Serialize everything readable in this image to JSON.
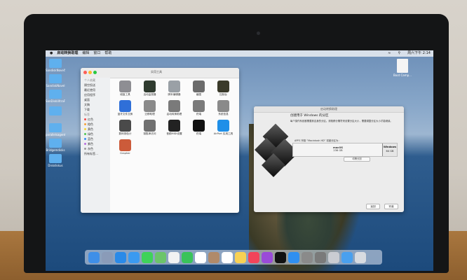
{
  "menubar": {
    "app": "启动转换助理",
    "items": [
      "编辑",
      "窗口",
      "帮助"
    ],
    "clock": "周六下午 2:14"
  },
  "desktop_icons": [
    {
      "label": "SandiskNovel5",
      "icon": "folder-icon"
    },
    {
      "label": "SandiskNovel",
      "icon": "folder-icon"
    },
    {
      "label": "SanDiskUltraFit",
      "icon": "folder-icon"
    },
    {
      "label": "",
      "icon": "folder-icon"
    },
    {
      "label": "parallelsagents",
      "icon": "folder-icon"
    },
    {
      "label": "Bridgemdisks",
      "icon": "folder-icon"
    },
    {
      "label": "Diskdiskus",
      "icon": "folder-icon"
    }
  ],
  "desktop_doc": {
    "label": "Boot Camp...",
    "icon": "document-icon"
  },
  "finder": {
    "title": "实用工具",
    "sidebar": [
      {
        "label": "个人收藏",
        "header": true
      },
      {
        "label": "隔空投送"
      },
      {
        "label": "最近使用"
      },
      {
        "label": "应用程序"
      },
      {
        "label": "桌面"
      },
      {
        "label": "文稿"
      },
      {
        "label": "下载"
      },
      {
        "label": "标签",
        "header": true
      },
      {
        "label": "红色",
        "color": "#f24a4a"
      },
      {
        "label": "橙色",
        "color": "#f4a23a"
      },
      {
        "label": "黄色",
        "color": "#f3d23b"
      },
      {
        "label": "绿色",
        "color": "#4bc553"
      },
      {
        "label": "蓝色",
        "color": "#3a8ef5"
      },
      {
        "label": "紫色",
        "color": "#b86ee0"
      },
      {
        "label": "灰色",
        "color": "#9a9a9a"
      },
      {
        "label": "所有标签…"
      }
    ],
    "apps": [
      {
        "label": "磁盘工具",
        "icon": "disk-utility-icon",
        "color": "#8e8e93"
      },
      {
        "label": "活动监视器",
        "icon": "activity-monitor-icon",
        "color": "#2f3b2f"
      },
      {
        "label": "脚本编辑器",
        "icon": "script-editor-icon",
        "color": "#9aa0a6"
      },
      {
        "label": "截图",
        "icon": "screenshot-icon",
        "color": "#6b6b6b"
      },
      {
        "label": "控制台",
        "icon": "console-icon",
        "color": "#3a3a2a"
      },
      {
        "label": "蓝牙文件交换",
        "icon": "bluetooth-icon",
        "color": "#2f6fd8"
      },
      {
        "label": "迁移助理",
        "icon": "migration-icon",
        "color": "#8a8a8a"
      },
      {
        "label": "启动转换助理",
        "icon": "bootcamp-icon",
        "color": "#7a7a7a"
      },
      {
        "label": "终端",
        "icon": "terminal-icon",
        "color": "#7a7a7a"
      },
      {
        "label": "系统信息",
        "icon": "system-info-icon",
        "color": "#8a8a8a"
      },
      {
        "label": "数码测色计",
        "icon": "colorimeter-icon",
        "color": "#4a4a4a"
      },
      {
        "label": "钥匙串访问",
        "icon": "keychain-icon",
        "color": "#707070"
      },
      {
        "label": "音频MIDI设置",
        "icon": "midi-icon",
        "color": "#222222"
      },
      {
        "label": "终端",
        "icon": "terminal-icon",
        "color": "#111111"
      },
      {
        "label": "AirPort 实用工具",
        "icon": "airport-icon",
        "color": "#1f8fe8"
      },
      {
        "label": "Grapher",
        "icon": "grapher-icon",
        "color": "#cc5b3a"
      }
    ]
  },
  "bootcamp": {
    "window_title": "启动转换助理",
    "heading": "创建用于 Windows 的分区",
    "description": "每个操作系统都需要其自身的分区。请拖移分隔符来设置分区大小，需要调整分区大小才能继续。",
    "partition_label": "APFS 宗卷 “Macintosh HD” 将被分区为：",
    "mac_partition": {
      "name": "macOS",
      "size": "236 GB"
    },
    "win_partition": {
      "name": "Windows",
      "size": "64 GB"
    },
    "divide_button": "均等分割",
    "back_button": "返回",
    "install_button": "安装"
  },
  "dock": {
    "apps": [
      {
        "icon": "finder-icon",
        "color": "#3f8fe8"
      },
      {
        "icon": "launchpad-icon",
        "color": "#8a9bb8"
      },
      {
        "icon": "safari-icon",
        "color": "#2a8ae8"
      },
      {
        "icon": "mail-icon",
        "color": "#3b9af0"
      },
      {
        "icon": "messages-icon",
        "color": "#3fd25a"
      },
      {
        "icon": "maps-icon",
        "color": "#6cc46a"
      },
      {
        "icon": "photos-icon",
        "color": "#f2f2f2"
      },
      {
        "icon": "facetime-icon",
        "color": "#3ac35a"
      },
      {
        "icon": "calendar-icon",
        "color": "#ffffff"
      },
      {
        "icon": "contacts-icon",
        "color": "#b08a6a"
      },
      {
        "icon": "reminders-icon",
        "color": "#ffffff"
      },
      {
        "icon": "notes-icon",
        "color": "#f7d154"
      },
      {
        "icon": "music-icon",
        "color": "#f2445a"
      },
      {
        "icon": "podcasts-icon",
        "color": "#9a4bd8"
      },
      {
        "icon": "tv-icon",
        "color": "#111111"
      },
      {
        "icon": "app-store-icon",
        "color": "#2f8ff0"
      },
      {
        "icon": "system-preferences-icon",
        "color": "#8a8a8a"
      },
      {
        "icon": "bootcamp-icon",
        "color": "#7a7a7a"
      },
      {
        "icon": "utilities-icon",
        "color": "#c9ccd2"
      },
      {
        "icon": "downloads-folder-icon",
        "color": "#4aa0ee"
      },
      {
        "icon": "trash-icon",
        "color": "#d8dbe0"
      }
    ]
  }
}
